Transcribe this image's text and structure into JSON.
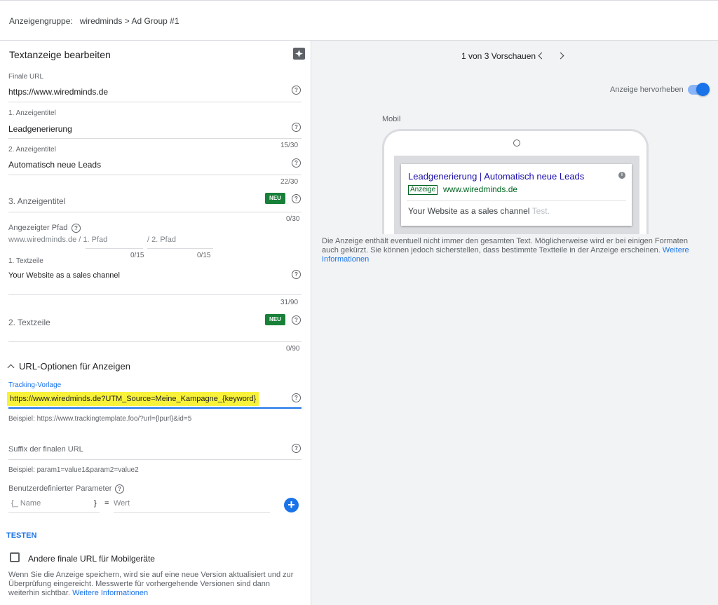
{
  "header": {
    "breadcrumb_label": "Anzeigengruppe:",
    "breadcrumb_value": "wiredminds > Ad Group #1"
  },
  "editor": {
    "title": "Textanzeige bearbeiten",
    "final_url": {
      "label": "Finale URL",
      "value": "https://www.wiredminds.de"
    },
    "headline1": {
      "label": "1. Anzeigentitel",
      "value": "Leadgenerierung",
      "counter": "15/30"
    },
    "headline2": {
      "label": "2. Anzeigentitel",
      "value": "Automatisch neue Leads",
      "counter": "22/30"
    },
    "headline3": {
      "label": "3. Anzeigentitel",
      "badge": "NEU",
      "counter": "0/30"
    },
    "display_path": {
      "label": "Angezeigter Pfad",
      "domain": "www.wiredminds.de / 1. Pfad",
      "path2": "/ 2. Pfad",
      "counter1": "0/15",
      "counter2": "0/15"
    },
    "desc1": {
      "label": "1. Textzeile",
      "value": "Your Website as a sales channel",
      "counter": "31/90"
    },
    "desc2": {
      "label": "2. Textzeile",
      "badge": "NEU",
      "counter": "0/90"
    },
    "url_options_title": "URL-Optionen für Anzeigen",
    "tracking": {
      "label": "Tracking-Vorlage",
      "value": "https://www.wiredminds.de?UTM_Source=Meine_Kampagne_{keyword}",
      "example": "Beispiel: https://www.trackingtemplate.foo/?url={lpurl}&id=5"
    },
    "suffix": {
      "placeholder": "Suffix der finalen URL",
      "example": "Beispiel: param1=value1&param2=value2"
    },
    "custom_param": {
      "label": "Benutzerdefinierter Parameter",
      "name_placeholder": "{_ Name",
      "brace_close": "}",
      "equals": "=",
      "value_placeholder": "Wert"
    },
    "test_heading": "TESTEN",
    "mobile_url_checkbox": "Andere finale URL für Mobilgeräte",
    "notice_text": "Wenn Sie die Anzeige speichern, wird sie auf eine neue Version aktualisiert und zur Überprüfung eingereicht. Messwerte für vorhergehende Versionen sind dann weiterhin sichtbar.",
    "notice_link": "Weitere Informationen"
  },
  "preview": {
    "pager": "1 von 3 Vorschauen",
    "highlight_label": "Anzeige hervorheben",
    "highlight_on": true,
    "device_label": "Mobil",
    "ad": {
      "title": "Leadgenerierung | Automatisch neue Leads",
      "badge": "Anzeige",
      "url": "www.wiredminds.de",
      "description": "Your Website as a sales channel",
      "placeholder": "Test."
    },
    "disclaimer": "Die Anzeige enthält eventuell nicht immer den gesamten Text. Möglicherweise wird er bei einigen Formaten auch gekürzt. Sie können jedoch sicherstellen, dass bestimmte Textteile in der Anzeige erscheinen.",
    "disclaimer_link": "Weitere Informationen"
  },
  "colors": {
    "accent": "#1a73e8",
    "badge_green": "#188038",
    "highlight_yellow": "#f8f23a"
  }
}
